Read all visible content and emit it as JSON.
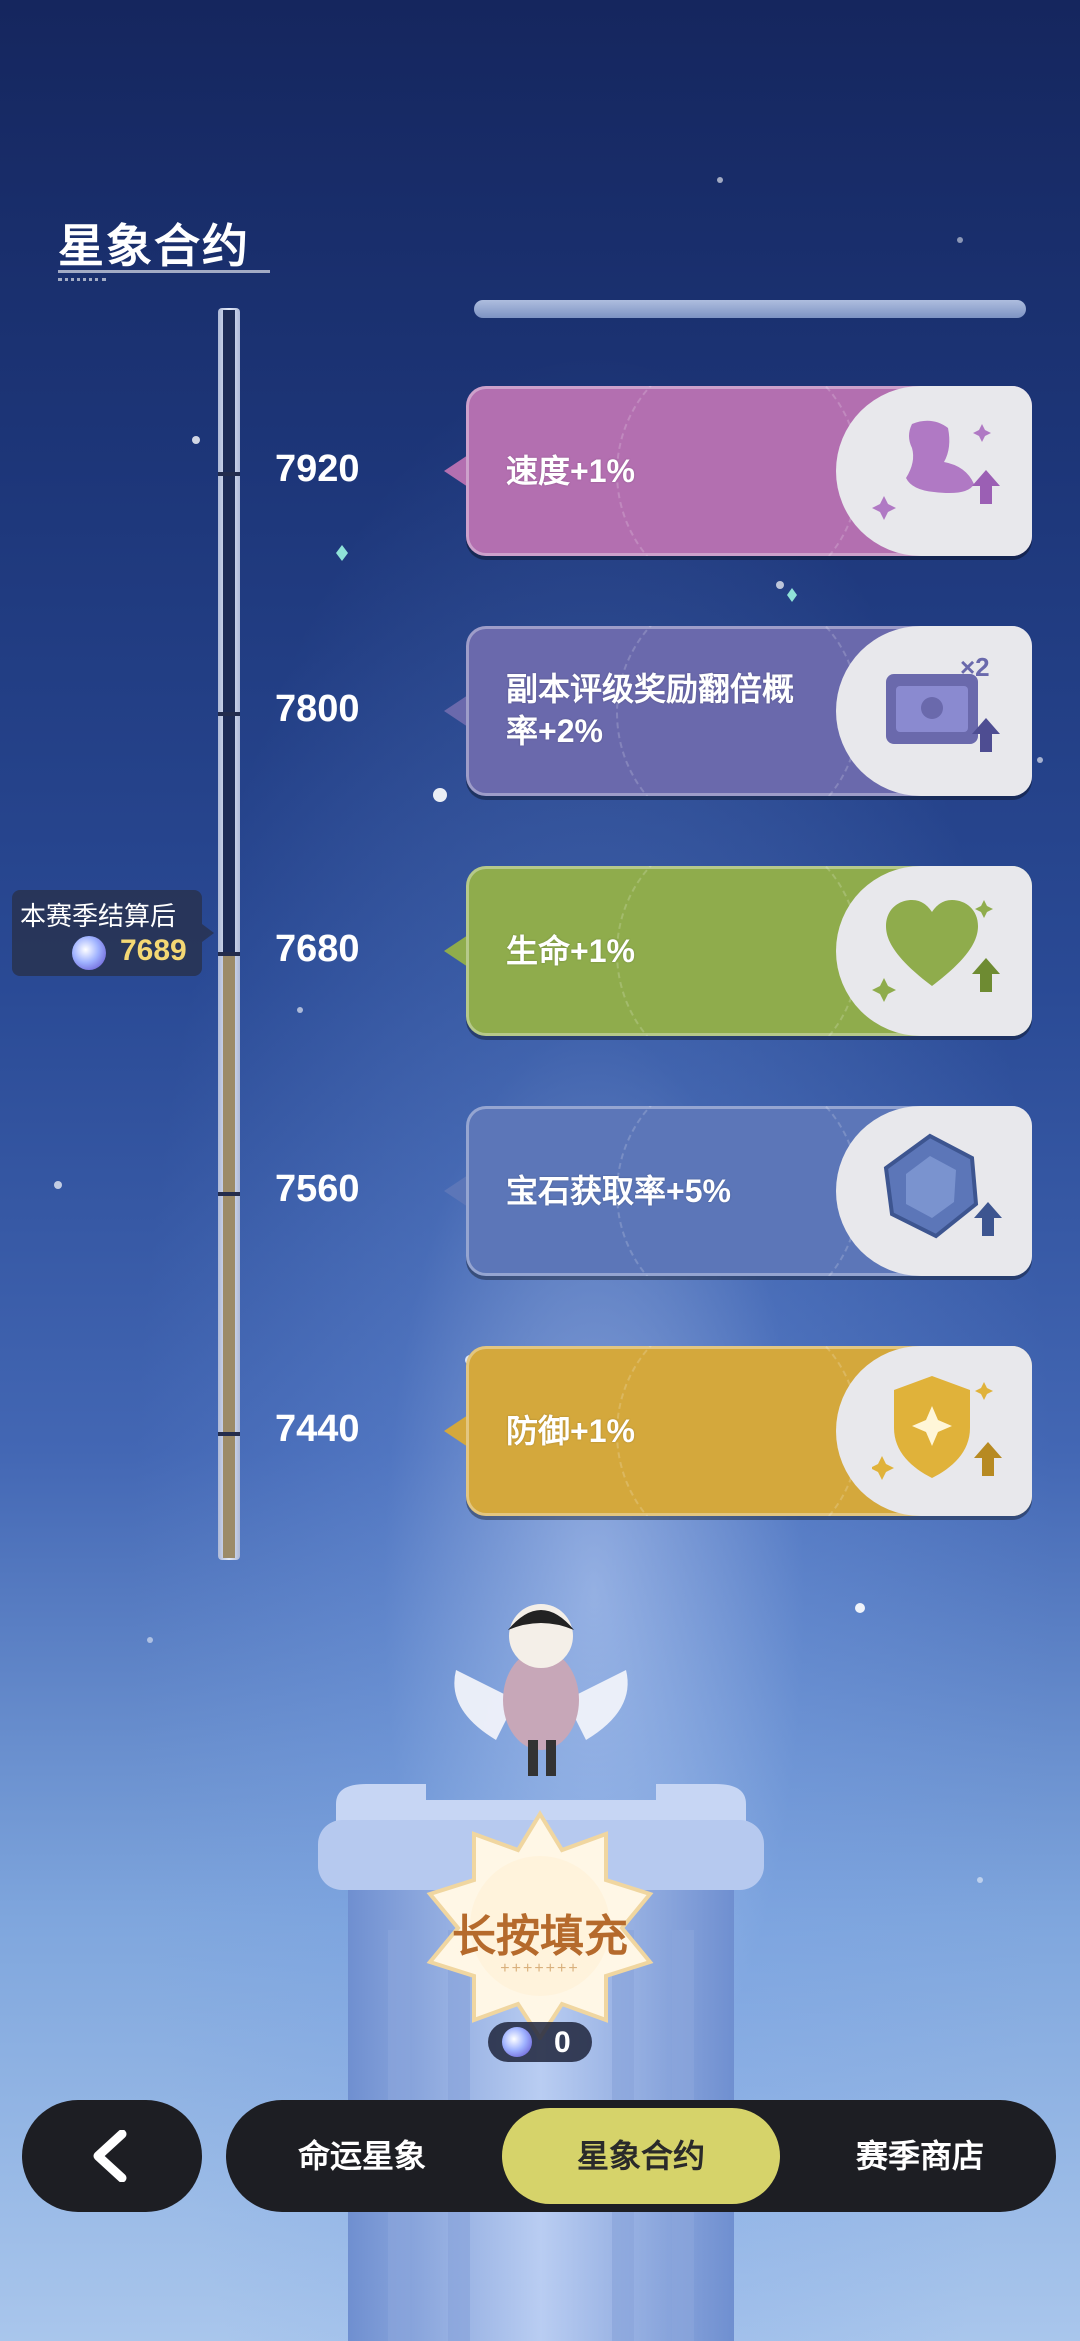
{
  "page_title": "星象合约",
  "current_marker": {
    "label": "本赛季结算后",
    "value": "7689"
  },
  "milestones": [
    {
      "level": "7920",
      "reward": "速度+1%",
      "icon": "speed-boot-icon"
    },
    {
      "level": "7800",
      "reward": "副本评级奖励翻倍概率+2%",
      "icon": "double-chest-icon",
      "badge": "×2"
    },
    {
      "level": "7680",
      "reward": "生命+1%",
      "icon": "heart-icon"
    },
    {
      "level": "7560",
      "reward": "宝石获取率+5%",
      "icon": "gem-icon"
    },
    {
      "level": "7440",
      "reward": "防御+1%",
      "icon": "shield-icon"
    }
  ],
  "fill_button": {
    "label": "长按填充",
    "dots": "+++++++",
    "cost": "0"
  },
  "nav": {
    "back": "back-arrow-icon",
    "tabs": [
      {
        "label": "命运星象",
        "active": false
      },
      {
        "label": "星象合约",
        "active": true
      },
      {
        "label": "赛季商店",
        "active": false
      }
    ]
  },
  "colors": {
    "speed": "#b36fb0",
    "chest": "#6a69ac",
    "life": "#8fac4c",
    "gem": "#5c76b8",
    "defense": "#d4a83c",
    "active_tab": "#d6d36a",
    "marker_value": "#f4d874"
  }
}
